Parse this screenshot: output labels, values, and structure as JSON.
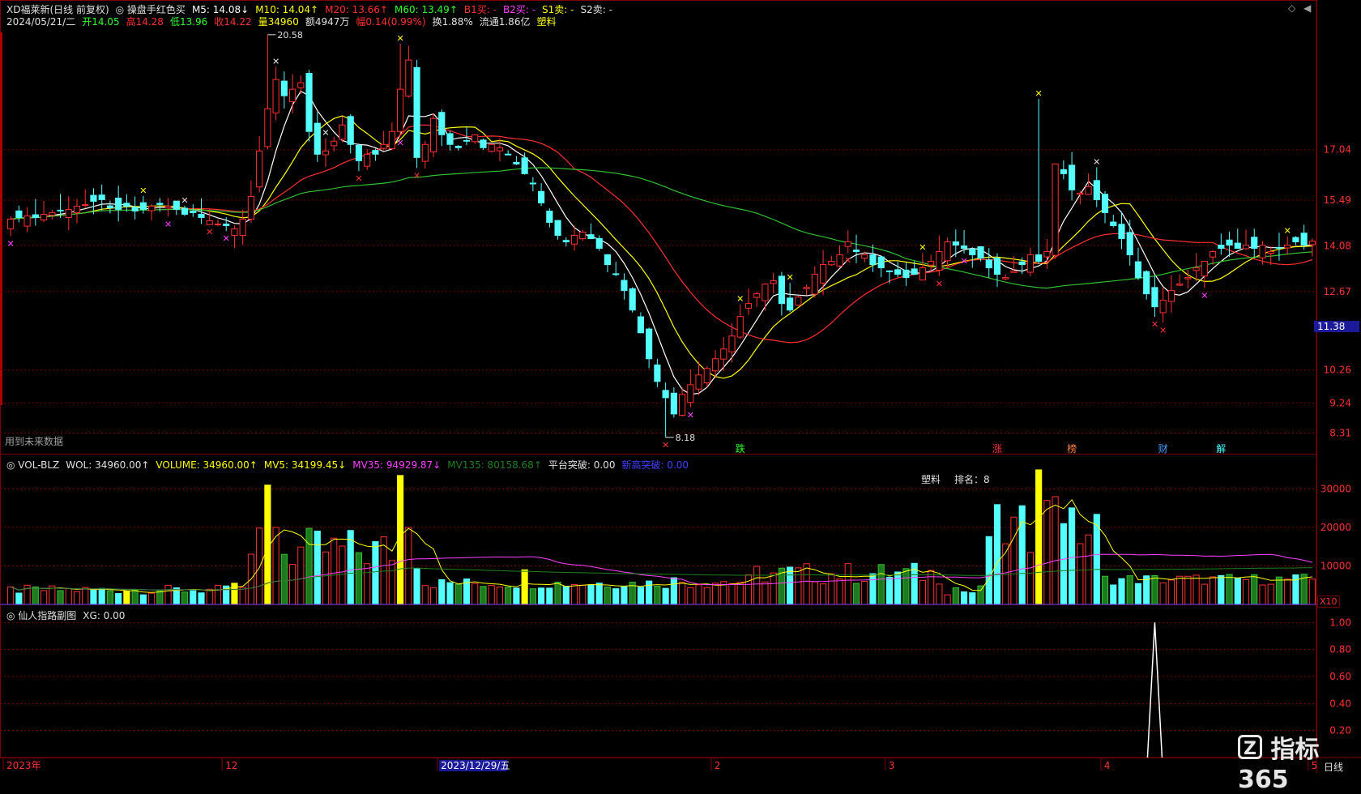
{
  "header": {
    "line1": [
      {
        "text": "XD福莱新(日线 前复权)",
        "color": "#e0e0e0"
      },
      {
        "text": "◎ 操盘手红色买",
        "color": "#e0e0e0"
      },
      {
        "text": "M5: 14.08↓",
        "color": "#ffffff"
      },
      {
        "text": "M10: 14.04↑",
        "color": "#ffff00"
      },
      {
        "text": "M20: 13.66↑",
        "color": "#ff3030"
      },
      {
        "text": "M60: 13.49↑",
        "color": "#30ff30"
      },
      {
        "text": "B1买: -",
        "color": "#ff3030"
      },
      {
        "text": "B2买: -",
        "color": "#ff40ff"
      },
      {
        "text": "S1卖: -",
        "color": "#ffff00"
      },
      {
        "text": "S2卖: -",
        "color": "#e0e0e0"
      }
    ],
    "line2": [
      {
        "text": "2024/05/21/二",
        "color": "#e0e0e0"
      },
      {
        "text": "开14.05",
        "color": "#30ff30"
      },
      {
        "text": "高14.28",
        "color": "#ff3030"
      },
      {
        "text": "低13.96",
        "color": "#30ff30"
      },
      {
        "text": "收14.22",
        "color": "#ff3030"
      },
      {
        "text": "量34960",
        "color": "#ffff00"
      },
      {
        "text": "额4947万",
        "color": "#e0e0e0"
      },
      {
        "text": "幅0.14(0.99%)",
        "color": "#ff3030"
      },
      {
        "text": "换1.88%",
        "color": "#e0e0e0"
      },
      {
        "text": "流通1.86亿",
        "color": "#e0e0e0"
      },
      {
        "text": "塑料",
        "color": "#ffff00"
      }
    ]
  },
  "main_panel": {
    "future_data_note": "用到未来数据",
    "price_labels": [
      "17.04",
      "15.49",
      "14.08",
      "12.67",
      "10.26",
      "9.24",
      "8.31"
    ],
    "current_price_tag": "11.38",
    "high_annotation": "20.58",
    "low_annotation": "8.18",
    "event_markers": [
      {
        "text": "跌",
        "color": "#30ff30"
      },
      {
        "text": "涨",
        "color": "#ff3030"
      },
      {
        "text": "榜",
        "color": "#ff8040"
      },
      {
        "text": "财",
        "color": "#40a0ff"
      },
      {
        "text": "解",
        "color": "#40ffff"
      }
    ]
  },
  "volume_panel": {
    "legend": [
      {
        "text": "◎ VOL-BLZ",
        "color": "#e0e0e0"
      },
      {
        "text": "WOL: 34960.00↑",
        "color": "#e0e0e0"
      },
      {
        "text": "VOLUME: 34960.00↑",
        "color": "#ffff00"
      },
      {
        "text": "MV5: 34199.45↓",
        "color": "#ffff00"
      },
      {
        "text": "MV35: 94929.87↓",
        "color": "#ff40ff"
      },
      {
        "text": "MV135: 80158.68↑",
        "color": "#208020"
      },
      {
        "text": "平台突破: 0.00",
        "color": "#e0e0e0"
      },
      {
        "text": "新高突破: 0.00",
        "color": "#4040ff"
      }
    ],
    "sector_label": "塑料",
    "rank_label": "排名：8",
    "axis_labels": [
      "30000",
      "20000",
      "10000"
    ],
    "unit_tag": "X10"
  },
  "sub_panel": {
    "legend": [
      {
        "text": "◎ 仙人指路副图",
        "color": "#e0e0e0"
      },
      {
        "text": "XG: 0.00",
        "color": "#e0e0e0"
      }
    ],
    "axis_labels": [
      "1.00",
      "0.80",
      "0.60",
      "0.40",
      "0.20"
    ]
  },
  "time_axis": {
    "labels": [
      "2023年",
      "12",
      "2023/12/29/五",
      "2",
      "3",
      "4",
      "5"
    ],
    "period": "日线"
  },
  "watermark": "指标365",
  "colors": {
    "up": "#ff3030",
    "down": "#54ffff",
    "ma5": "#ffffff",
    "ma10": "#ffff00",
    "ma20": "#ff3030",
    "ma60": "#30c030",
    "grid": "#700000"
  },
  "chart_data": {
    "type": "candlestick",
    "price_range": [
      8.18,
      20.58
    ],
    "closes": [
      14.9,
      14.95,
      15.0,
      14.95,
      15.05,
      15.1,
      15.15,
      15.2,
      15.3,
      15.35,
      15.45,
      15.5,
      15.25,
      15.2,
      15.3,
      15.15,
      15.2,
      15.3,
      15.35,
      15.3,
      15.2,
      15.05,
      15.1,
      14.95,
      14.85,
      14.75,
      14.7,
      14.6,
      14.9,
      15.6,
      17.0,
      18.3,
      19.2,
      18.7,
      18.9,
      19.1,
      17.6,
      16.9,
      17.0,
      17.3,
      17.8,
      17.2,
      16.7,
      16.9,
      16.9,
      17.2,
      17.6,
      18.9,
      19.8,
      16.8,
      17.2,
      18.0,
      17.5,
      17.2,
      17.1,
      17.3,
      17.5,
      17.1,
      17.2,
      17.1,
      16.9,
      16.6,
      16.3,
      16.0,
      15.4,
      14.8,
      14.4,
      14.2,
      14.4,
      14.5,
      14.3,
      14.0,
      13.5,
      13.2,
      12.7,
      12.1,
      11.4,
      10.6,
      9.9,
      9.4,
      8.9,
      9.5,
      9.8,
      10.1,
      10.3,
      10.6,
      10.9,
      11.3,
      11.9,
      12.3,
      12.6,
      12.9,
      13.0,
      12.3,
      12.1,
      12.5,
      12.8,
      13.2,
      13.5,
      13.6,
      13.8,
      14.2,
      13.9,
      13.8,
      13.5,
      13.4,
      13.3,
      13.2,
      13.1,
      13.2,
      13.4,
      13.6,
      13.9,
      14.2,
      14.1,
      14.0,
      13.8,
      13.7,
      13.4,
      13.2,
      13.1,
      13.3,
      13.5,
      13.8,
      13.6,
      13.9,
      16.6,
      16.3,
      15.8,
      15.7,
      15.9,
      15.5,
      15.1,
      14.7,
      14.3,
      13.8,
      13.1,
      12.6,
      12.2,
      12.4,
      12.7,
      12.9,
      13.1,
      13.4,
      13.6,
      13.9,
      14.0,
      14.1,
      14.0,
      14.1,
      14.0,
      14.1,
      13.9,
      14.0,
      14.1,
      14.2,
      14.1,
      14.22
    ],
    "volume_range": [
      0,
      34960
    ],
    "xg_peak": 1.0
  }
}
